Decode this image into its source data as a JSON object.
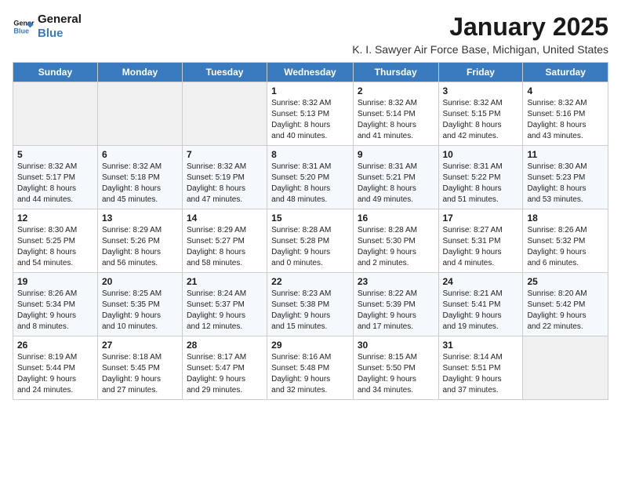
{
  "logo": {
    "line1": "General",
    "line2": "Blue"
  },
  "title": "January 2025",
  "subtitle": "K. I. Sawyer Air Force Base, Michigan, United States",
  "header_colors": {
    "accent": "#3a7bbf"
  },
  "columns": [
    "Sunday",
    "Monday",
    "Tuesday",
    "Wednesday",
    "Thursday",
    "Friday",
    "Saturday"
  ],
  "weeks": [
    [
      {
        "day": "",
        "detail": ""
      },
      {
        "day": "",
        "detail": ""
      },
      {
        "day": "",
        "detail": ""
      },
      {
        "day": "1",
        "detail": "Sunrise: 8:32 AM\nSunset: 5:13 PM\nDaylight: 8 hours\nand 40 minutes."
      },
      {
        "day": "2",
        "detail": "Sunrise: 8:32 AM\nSunset: 5:14 PM\nDaylight: 8 hours\nand 41 minutes."
      },
      {
        "day": "3",
        "detail": "Sunrise: 8:32 AM\nSunset: 5:15 PM\nDaylight: 8 hours\nand 42 minutes."
      },
      {
        "day": "4",
        "detail": "Sunrise: 8:32 AM\nSunset: 5:16 PM\nDaylight: 8 hours\nand 43 minutes."
      }
    ],
    [
      {
        "day": "5",
        "detail": "Sunrise: 8:32 AM\nSunset: 5:17 PM\nDaylight: 8 hours\nand 44 minutes."
      },
      {
        "day": "6",
        "detail": "Sunrise: 8:32 AM\nSunset: 5:18 PM\nDaylight: 8 hours\nand 45 minutes."
      },
      {
        "day": "7",
        "detail": "Sunrise: 8:32 AM\nSunset: 5:19 PM\nDaylight: 8 hours\nand 47 minutes."
      },
      {
        "day": "8",
        "detail": "Sunrise: 8:31 AM\nSunset: 5:20 PM\nDaylight: 8 hours\nand 48 minutes."
      },
      {
        "day": "9",
        "detail": "Sunrise: 8:31 AM\nSunset: 5:21 PM\nDaylight: 8 hours\nand 49 minutes."
      },
      {
        "day": "10",
        "detail": "Sunrise: 8:31 AM\nSunset: 5:22 PM\nDaylight: 8 hours\nand 51 minutes."
      },
      {
        "day": "11",
        "detail": "Sunrise: 8:30 AM\nSunset: 5:23 PM\nDaylight: 8 hours\nand 53 minutes."
      }
    ],
    [
      {
        "day": "12",
        "detail": "Sunrise: 8:30 AM\nSunset: 5:25 PM\nDaylight: 8 hours\nand 54 minutes."
      },
      {
        "day": "13",
        "detail": "Sunrise: 8:29 AM\nSunset: 5:26 PM\nDaylight: 8 hours\nand 56 minutes."
      },
      {
        "day": "14",
        "detail": "Sunrise: 8:29 AM\nSunset: 5:27 PM\nDaylight: 8 hours\nand 58 minutes."
      },
      {
        "day": "15",
        "detail": "Sunrise: 8:28 AM\nSunset: 5:28 PM\nDaylight: 9 hours\nand 0 minutes."
      },
      {
        "day": "16",
        "detail": "Sunrise: 8:28 AM\nSunset: 5:30 PM\nDaylight: 9 hours\nand 2 minutes."
      },
      {
        "day": "17",
        "detail": "Sunrise: 8:27 AM\nSunset: 5:31 PM\nDaylight: 9 hours\nand 4 minutes."
      },
      {
        "day": "18",
        "detail": "Sunrise: 8:26 AM\nSunset: 5:32 PM\nDaylight: 9 hours\nand 6 minutes."
      }
    ],
    [
      {
        "day": "19",
        "detail": "Sunrise: 8:26 AM\nSunset: 5:34 PM\nDaylight: 9 hours\nand 8 minutes."
      },
      {
        "day": "20",
        "detail": "Sunrise: 8:25 AM\nSunset: 5:35 PM\nDaylight: 9 hours\nand 10 minutes."
      },
      {
        "day": "21",
        "detail": "Sunrise: 8:24 AM\nSunset: 5:37 PM\nDaylight: 9 hours\nand 12 minutes."
      },
      {
        "day": "22",
        "detail": "Sunrise: 8:23 AM\nSunset: 5:38 PM\nDaylight: 9 hours\nand 15 minutes."
      },
      {
        "day": "23",
        "detail": "Sunrise: 8:22 AM\nSunset: 5:39 PM\nDaylight: 9 hours\nand 17 minutes."
      },
      {
        "day": "24",
        "detail": "Sunrise: 8:21 AM\nSunset: 5:41 PM\nDaylight: 9 hours\nand 19 minutes."
      },
      {
        "day": "25",
        "detail": "Sunrise: 8:20 AM\nSunset: 5:42 PM\nDaylight: 9 hours\nand 22 minutes."
      }
    ],
    [
      {
        "day": "26",
        "detail": "Sunrise: 8:19 AM\nSunset: 5:44 PM\nDaylight: 9 hours\nand 24 minutes."
      },
      {
        "day": "27",
        "detail": "Sunrise: 8:18 AM\nSunset: 5:45 PM\nDaylight: 9 hours\nand 27 minutes."
      },
      {
        "day": "28",
        "detail": "Sunrise: 8:17 AM\nSunset: 5:47 PM\nDaylight: 9 hours\nand 29 minutes."
      },
      {
        "day": "29",
        "detail": "Sunrise: 8:16 AM\nSunset: 5:48 PM\nDaylight: 9 hours\nand 32 minutes."
      },
      {
        "day": "30",
        "detail": "Sunrise: 8:15 AM\nSunset: 5:50 PM\nDaylight: 9 hours\nand 34 minutes."
      },
      {
        "day": "31",
        "detail": "Sunrise: 8:14 AM\nSunset: 5:51 PM\nDaylight: 9 hours\nand 37 minutes."
      },
      {
        "day": "",
        "detail": ""
      }
    ]
  ]
}
